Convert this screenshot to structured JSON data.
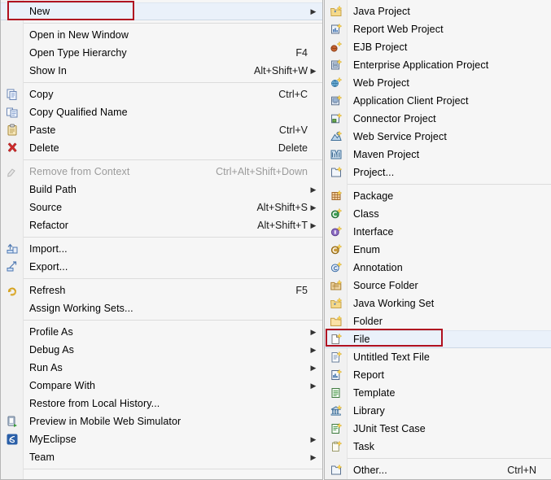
{
  "window": {
    "kind": "eclipse-context-menu",
    "background_color": "#f0f0f0",
    "menu_background": "#f6f6f6",
    "highlight_color": "#eaf1fa",
    "annotation_color": "#b01020"
  },
  "context_menu": {
    "name": "project-explorer-context-menu",
    "groups": [
      {
        "items": [
          {
            "label": "New",
            "accel": "",
            "submenu": true,
            "icon": "",
            "selected": true,
            "disabled": false
          }
        ]
      },
      {
        "items": [
          {
            "label": "Open in New Window",
            "accel": "",
            "submenu": false,
            "icon": "",
            "selected": false,
            "disabled": false
          },
          {
            "label": "Open Type Hierarchy",
            "accel": "F4",
            "submenu": false,
            "icon": "",
            "selected": false,
            "disabled": false
          },
          {
            "label": "Show In",
            "accel": "Alt+Shift+W",
            "submenu": true,
            "icon": "",
            "selected": false,
            "disabled": false
          }
        ]
      },
      {
        "items": [
          {
            "label": "Copy",
            "accel": "Ctrl+C",
            "submenu": false,
            "icon": "copy-icon",
            "selected": false,
            "disabled": false
          },
          {
            "label": "Copy Qualified Name",
            "accel": "",
            "submenu": false,
            "icon": "copy-qualified-name-icon",
            "selected": false,
            "disabled": false
          },
          {
            "label": "Paste",
            "accel": "Ctrl+V",
            "submenu": false,
            "icon": "paste-icon",
            "selected": false,
            "disabled": false
          },
          {
            "label": "Delete",
            "accel": "Delete",
            "submenu": false,
            "icon": "delete-icon",
            "selected": false,
            "disabled": false
          }
        ]
      },
      {
        "items": [
          {
            "label": "Remove from Context",
            "accel": "Ctrl+Alt+Shift+Down",
            "submenu": false,
            "icon": "remove-from-context-icon",
            "selected": false,
            "disabled": true
          },
          {
            "label": "Build Path",
            "accel": "",
            "submenu": true,
            "icon": "",
            "selected": false,
            "disabled": false
          },
          {
            "label": "Source",
            "accel": "Alt+Shift+S",
            "submenu": true,
            "icon": "",
            "selected": false,
            "disabled": false
          },
          {
            "label": "Refactor",
            "accel": "Alt+Shift+T",
            "submenu": true,
            "icon": "",
            "selected": false,
            "disabled": false
          }
        ]
      },
      {
        "items": [
          {
            "label": "Import...",
            "accel": "",
            "submenu": false,
            "icon": "import-icon",
            "selected": false,
            "disabled": false
          },
          {
            "label": "Export...",
            "accel": "",
            "submenu": false,
            "icon": "export-icon",
            "selected": false,
            "disabled": false
          }
        ]
      },
      {
        "items": [
          {
            "label": "Refresh",
            "accel": "F5",
            "submenu": false,
            "icon": "refresh-icon",
            "selected": false,
            "disabled": false
          },
          {
            "label": "Assign Working Sets...",
            "accel": "",
            "submenu": false,
            "icon": "",
            "selected": false,
            "disabled": false
          }
        ]
      },
      {
        "items": [
          {
            "label": "Profile As",
            "accel": "",
            "submenu": true,
            "icon": "",
            "selected": false,
            "disabled": false
          },
          {
            "label": "Debug As",
            "accel": "",
            "submenu": true,
            "icon": "",
            "selected": false,
            "disabled": false
          },
          {
            "label": "Run As",
            "accel": "",
            "submenu": true,
            "icon": "",
            "selected": false,
            "disabled": false
          },
          {
            "label": "Compare With",
            "accel": "",
            "submenu": true,
            "icon": "",
            "selected": false,
            "disabled": false
          },
          {
            "label": "Restore from Local History...",
            "accel": "",
            "submenu": false,
            "icon": "",
            "selected": false,
            "disabled": false
          },
          {
            "label": "Preview in Mobile Web Simulator",
            "accel": "",
            "submenu": false,
            "icon": "mobile-web-simulator-icon",
            "selected": false,
            "disabled": false
          },
          {
            "label": "MyEclipse",
            "accel": "",
            "submenu": true,
            "icon": "myeclipse-icon",
            "selected": false,
            "disabled": false
          },
          {
            "label": "Team",
            "accel": "",
            "submenu": true,
            "icon": "",
            "selected": false,
            "disabled": false
          }
        ]
      }
    ]
  },
  "new_submenu": {
    "name": "new-submenu",
    "groups": [
      {
        "items": [
          {
            "label": "Java Project",
            "accel": "",
            "submenu": false,
            "icon": "java-project-icon",
            "selected": false,
            "disabled": false
          },
          {
            "label": "Report Web Project",
            "accel": "",
            "submenu": false,
            "icon": "report-web-project-icon",
            "selected": false,
            "disabled": false
          },
          {
            "label": "EJB Project",
            "accel": "",
            "submenu": false,
            "icon": "ejb-project-icon",
            "selected": false,
            "disabled": false
          },
          {
            "label": "Enterprise Application Project",
            "accel": "",
            "submenu": false,
            "icon": "enterprise-application-project-icon",
            "selected": false,
            "disabled": false
          },
          {
            "label": "Web Project",
            "accel": "",
            "submenu": false,
            "icon": "web-project-icon",
            "selected": false,
            "disabled": false
          },
          {
            "label": "Application Client Project",
            "accel": "",
            "submenu": false,
            "icon": "application-client-project-icon",
            "selected": false,
            "disabled": false
          },
          {
            "label": "Connector Project",
            "accel": "",
            "submenu": false,
            "icon": "connector-project-icon",
            "selected": false,
            "disabled": false
          },
          {
            "label": "Web Service Project",
            "accel": "",
            "submenu": false,
            "icon": "web-service-project-icon",
            "selected": false,
            "disabled": false
          },
          {
            "label": "Maven Project",
            "accel": "",
            "submenu": false,
            "icon": "maven-project-icon",
            "selected": false,
            "disabled": false
          },
          {
            "label": "Project...",
            "accel": "",
            "submenu": false,
            "icon": "project-icon",
            "selected": false,
            "disabled": false
          }
        ]
      },
      {
        "items": [
          {
            "label": "Package",
            "accel": "",
            "submenu": false,
            "icon": "package-icon",
            "selected": false,
            "disabled": false
          },
          {
            "label": "Class",
            "accel": "",
            "submenu": false,
            "icon": "class-icon",
            "selected": false,
            "disabled": false
          },
          {
            "label": "Interface",
            "accel": "",
            "submenu": false,
            "icon": "interface-icon",
            "selected": false,
            "disabled": false
          },
          {
            "label": "Enum",
            "accel": "",
            "submenu": false,
            "icon": "enum-icon",
            "selected": false,
            "disabled": false
          },
          {
            "label": "Annotation",
            "accel": "",
            "submenu": false,
            "icon": "annotation-icon",
            "selected": false,
            "disabled": false
          },
          {
            "label": "Source Folder",
            "accel": "",
            "submenu": false,
            "icon": "source-folder-icon",
            "selected": false,
            "disabled": false
          },
          {
            "label": "Java Working Set",
            "accel": "",
            "submenu": false,
            "icon": "java-working-set-icon",
            "selected": false,
            "disabled": false
          },
          {
            "label": "Folder",
            "accel": "",
            "submenu": false,
            "icon": "folder-icon",
            "selected": false,
            "disabled": false
          },
          {
            "label": "File",
            "accel": "",
            "submenu": false,
            "icon": "file-icon",
            "selected": true,
            "disabled": false
          },
          {
            "label": "Untitled Text File",
            "accel": "",
            "submenu": false,
            "icon": "untitled-text-file-icon",
            "selected": false,
            "disabled": false
          },
          {
            "label": "Report",
            "accel": "",
            "submenu": false,
            "icon": "report-icon",
            "selected": false,
            "disabled": false
          },
          {
            "label": "Template",
            "accel": "",
            "submenu": false,
            "icon": "template-icon",
            "selected": false,
            "disabled": false
          },
          {
            "label": "Library",
            "accel": "",
            "submenu": false,
            "icon": "library-icon",
            "selected": false,
            "disabled": false
          },
          {
            "label": "JUnit Test Case",
            "accel": "",
            "submenu": false,
            "icon": "junit-test-case-icon",
            "selected": false,
            "disabled": false
          },
          {
            "label": "Task",
            "accel": "",
            "submenu": false,
            "icon": "task-icon",
            "selected": false,
            "disabled": false
          }
        ]
      },
      {
        "items": [
          {
            "label": "Other...",
            "accel": "Ctrl+N",
            "submenu": false,
            "icon": "other-icon",
            "selected": false,
            "disabled": false
          }
        ]
      }
    ]
  },
  "annotations": [
    {
      "name": "new-annotation",
      "target": "New"
    },
    {
      "name": "file-annotation",
      "target": "File"
    }
  ]
}
